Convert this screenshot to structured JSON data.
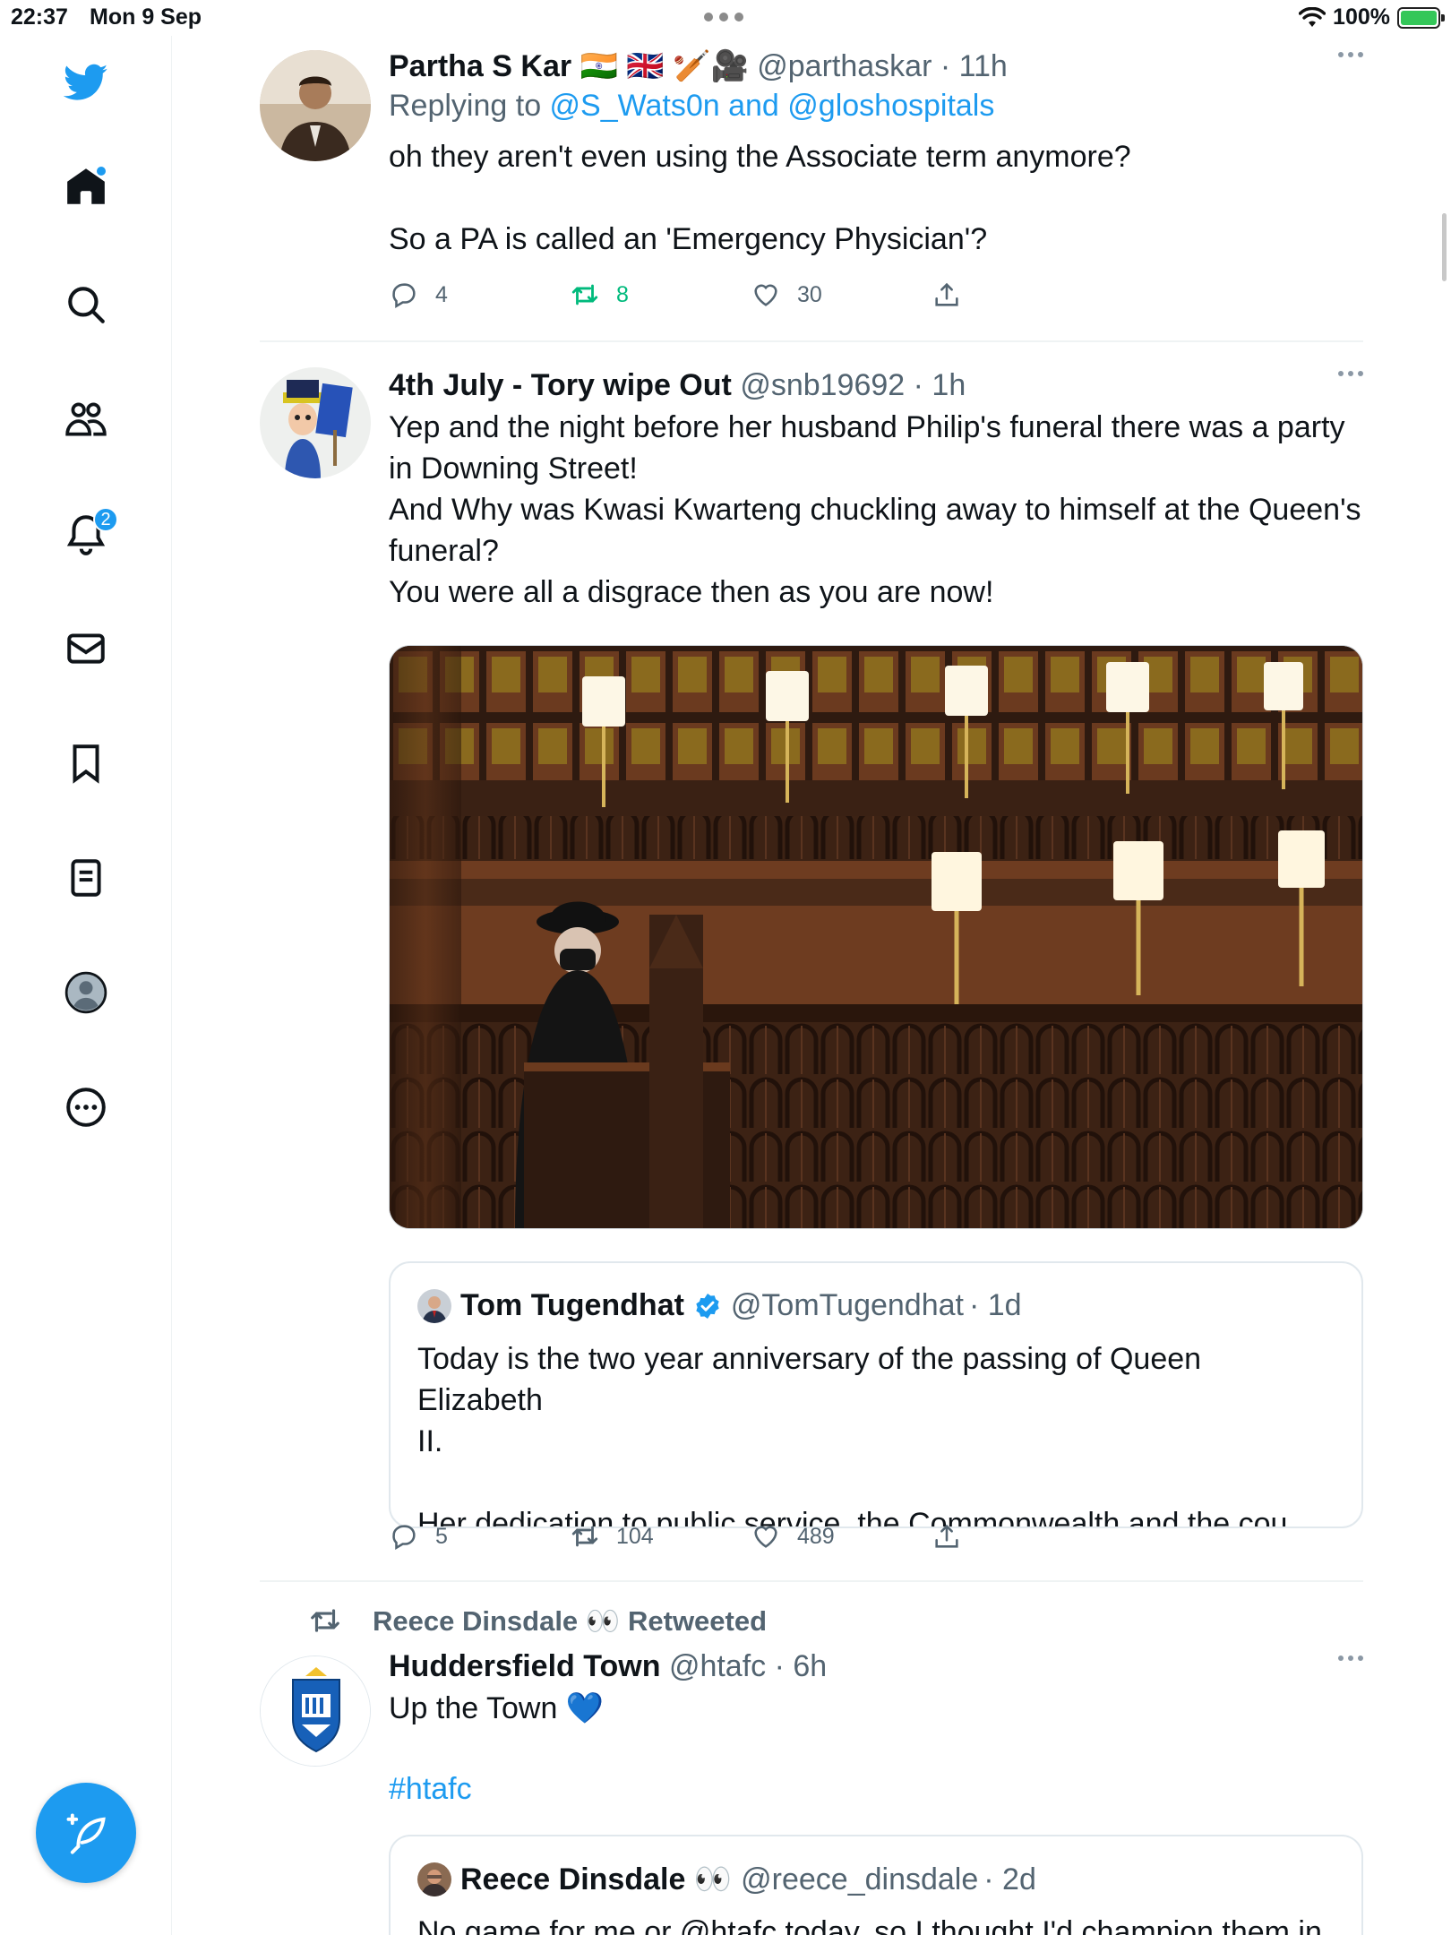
{
  "status": {
    "time": "22:37",
    "date": "Mon 9 Sep",
    "battery": "100%"
  },
  "sidebar": {
    "notifications_badge": "2",
    "items": [
      {
        "name": "home",
        "icon": "home-icon"
      },
      {
        "name": "explore",
        "icon": "search-icon"
      },
      {
        "name": "communities",
        "icon": "communities-icon"
      },
      {
        "name": "notifications",
        "icon": "bell-icon"
      },
      {
        "name": "messages",
        "icon": "mail-icon"
      },
      {
        "name": "bookmarks",
        "icon": "bookmark-icon"
      },
      {
        "name": "lists",
        "icon": "list-icon"
      },
      {
        "name": "profile",
        "icon": "profile-icon"
      },
      {
        "name": "more",
        "icon": "more-circle-icon"
      }
    ]
  },
  "tweets": [
    {
      "name": "Partha S Kar",
      "emoji": "🇮🇳 🇬🇧 🏏🎥",
      "handle": "@parthaskar",
      "time": "· 11h",
      "replying_prefix": "Replying to ",
      "replying_to": "@S_Wats0n and @gloshospitals",
      "text": "oh they aren't even using the Associate term anymore?\n\nSo a PA is called an 'Emergency Physician'?",
      "replies": "4",
      "retweets": "8",
      "likes": "30"
    },
    {
      "name": "4th July - Tory wipe Out",
      "handle": "@snb19692",
      "time": "· 1h",
      "text": "Yep and the night before her husband Philip's funeral there was a party\nin Downing Street!\nAnd Why was Kwasi Kwarteng chuckling away to himself at the Queen's\nfuneral?\nYou were all a disgrace then as you are now!",
      "quote": {
        "name": "Tom Tugendhat",
        "handle": "@TomTugendhat",
        "time": "· 1d",
        "text": "Today is the two year anniversary of the passing of Queen Elizabeth\nII.\n\nHer dedication to public service, the Commonwealth and the cou…"
      },
      "replies": "5",
      "retweets": "104",
      "likes": "489"
    },
    {
      "retweeted_by": "Reece Dinsdale 👀 Retweeted",
      "name": "Huddersfield Town",
      "handle": "@htafc",
      "time": "· 6h",
      "text": "Up the Town 💙",
      "hashtag": "#htafc",
      "quote": {
        "name": "Reece Dinsdale 👀",
        "handle": "@reece_dinsdale",
        "time": "· 2d",
        "text": "No game for me or @htafc today, so I thought I'd champion them in"
      }
    }
  ],
  "colors": {
    "accent": "#1d9bf0",
    "retweet_active": "#00ba7c",
    "muted": "#536471"
  }
}
